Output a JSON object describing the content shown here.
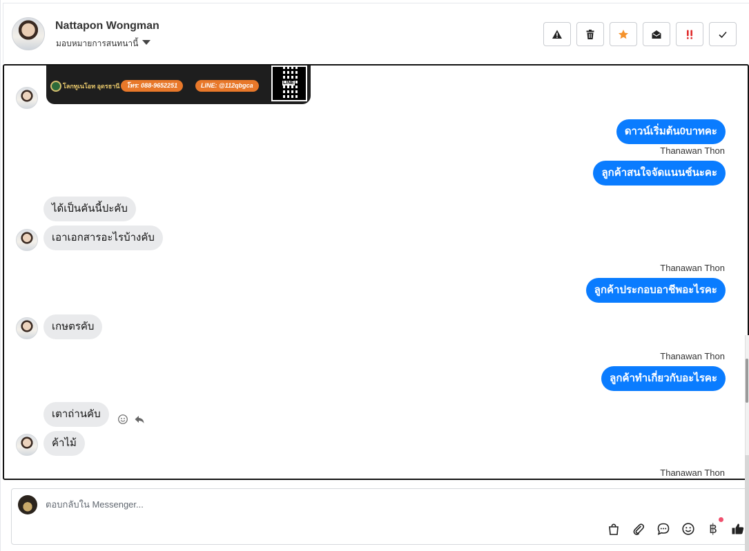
{
  "header": {
    "contact_name": "Nattapon Wongman",
    "assign_label": "มอบหมายการสนทนานี้",
    "actions": [
      {
        "name": "spam-button",
        "icon": "warning-icon"
      },
      {
        "name": "delete-button",
        "icon": "trash-icon"
      },
      {
        "name": "star-button",
        "icon": "star-icon",
        "color": "#f5922b"
      },
      {
        "name": "mark-unread-button",
        "icon": "envelope-open-icon"
      },
      {
        "name": "important-button",
        "icon": "double-exclamation-icon",
        "color": "#e02a2a"
      },
      {
        "name": "done-button",
        "icon": "check-icon"
      }
    ]
  },
  "banner": {
    "brand": "โลกทูเนโอท อุดรธานี",
    "phone": "โทร: 088-9652251",
    "line": "LINE: @112qbgca",
    "qr_label": "LINE"
  },
  "messages": {
    "out_1": "ดาวน์เริ่มต้น0บาทคะ",
    "sender_1": "Thanawan Thon",
    "out_2": "ลูกค้าสนใจจัดแนนช์นะคะ",
    "in_1": "ได้เป็นคันนี้ปะคับ",
    "in_2": "เอาเอกสารอะไรบ้างคับ",
    "sender_2": "Thanawan Thon",
    "out_3": "ลูกค้าประกอบอาชีพอะไรคะ",
    "in_3": "เกษตรคับ",
    "sender_3": "Thanawan Thon",
    "out_4": "ลูกค้าทำเกี่ยวกับอะไรคะ",
    "in_4": "เตาถ่านคับ",
    "in_5": "ค้าไม้",
    "sender_4": "Thanawan Thon"
  },
  "composer": {
    "placeholder": "ตอบกลับใน Messenger...",
    "tools": [
      "shopping-bag-icon",
      "paperclip-icon",
      "saved-reply-icon",
      "emoji-icon",
      "baht-icon",
      "thumbs-up-icon"
    ],
    "baht_symbol": "฿",
    "accent": "#0a7cff"
  }
}
